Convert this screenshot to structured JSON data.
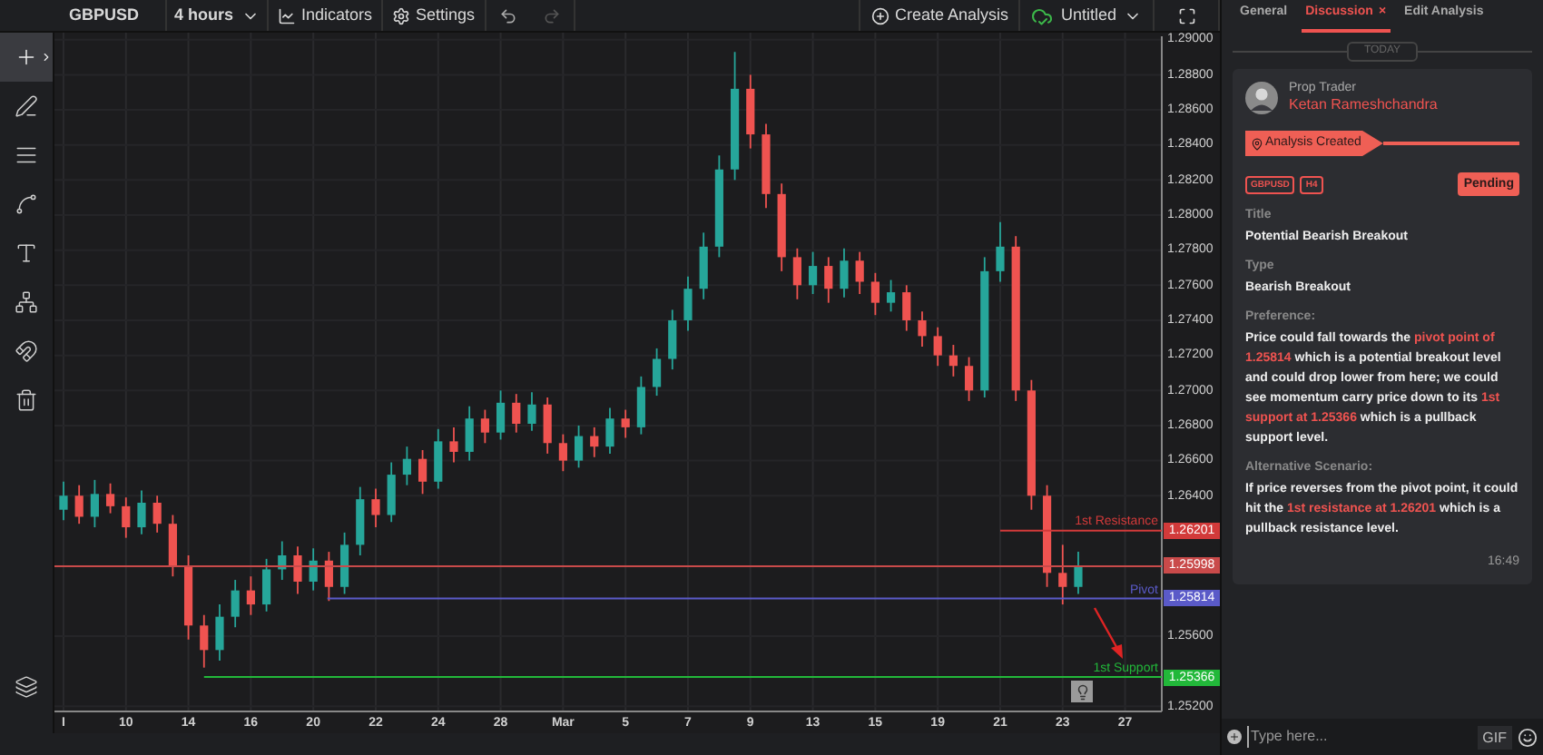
{
  "toolbar": {
    "symbol": "GBPUSD",
    "interval": "4 hours",
    "indicators": "Indicators",
    "settings": "Settings",
    "undo_disabled": false,
    "redo_disabled": true,
    "create": "Create Analysis",
    "layout": "Untitled"
  },
  "tools": [
    {
      "selected": true
    },
    {
      "selected": false
    },
    {
      "selected": false
    },
    {
      "selected": false
    },
    {
      "selected": false
    },
    {
      "selected": false
    },
    {
      "selected": false
    },
    {
      "selected": false
    },
    {
      "selected": false
    }
  ],
  "chart": {
    "chart_data": {
      "type": "candlestick",
      "ylim": [
        1.2517,
        1.2904
      ],
      "grid": true,
      "ref_lines": [
        {
          "axis": "y",
          "value": 1.26201,
          "color": "#d23a3a"
        },
        {
          "axis": "y",
          "value": 1.25998,
          "color": "#c94a4a"
        },
        {
          "axis": "y",
          "value": 1.25814,
          "color": "#5a5ac8"
        },
        {
          "axis": "y",
          "value": 1.25366,
          "color": "#22b83a"
        }
      ],
      "categories": [
        "I",
        null,
        null,
        null,
        "10",
        null,
        null,
        null,
        "14",
        null,
        null,
        null,
        "16",
        null,
        null,
        null,
        "20",
        null,
        null,
        null,
        "22",
        null,
        null,
        null,
        "24",
        null,
        null,
        null,
        "28",
        null,
        null,
        null,
        "Mar",
        null,
        null,
        null,
        "5",
        null,
        null,
        null,
        "7",
        null,
        null,
        null,
        "9",
        null,
        null,
        null,
        "13",
        null,
        null,
        null,
        "15",
        null,
        null,
        null,
        "19",
        null,
        null,
        null,
        "21",
        null,
        null,
        null,
        "23",
        null,
        null,
        null,
        "27"
      ],
      "ohlc": [
        [
          1.2632,
          1.2648,
          1.2626,
          1.264
        ],
        [
          1.264,
          1.2646,
          1.2624,
          1.2628
        ],
        [
          1.2628,
          1.2649,
          1.2622,
          1.2641
        ],
        [
          1.2641,
          1.2647,
          1.263,
          1.2634
        ],
        [
          1.2634,
          1.2639,
          1.2616,
          1.2622
        ],
        [
          1.2622,
          1.2643,
          1.2618,
          1.2636
        ],
        [
          1.2636,
          1.264,
          1.2619,
          1.2624
        ],
        [
          1.2624,
          1.2629,
          1.2594,
          1.26
        ],
        [
          1.26,
          1.2606,
          1.2558,
          1.2566
        ],
        [
          1.2566,
          1.2572,
          1.2542,
          1.2552
        ],
        [
          1.2552,
          1.2578,
          1.2546,
          1.2571
        ],
        [
          1.2571,
          1.2592,
          1.2565,
          1.2586
        ],
        [
          1.2586,
          1.2594,
          1.2572,
          1.2578
        ],
        [
          1.2578,
          1.2604,
          1.2574,
          1.2598
        ],
        [
          1.2598,
          1.2614,
          1.2592,
          1.2606
        ],
        [
          1.2606,
          1.2611,
          1.2584,
          1.2591
        ],
        [
          1.2591,
          1.261,
          1.2586,
          1.2603
        ],
        [
          1.2603,
          1.2608,
          1.258,
          1.2588
        ],
        [
          1.2588,
          1.2619,
          1.2584,
          1.2612
        ],
        [
          1.2612,
          1.2645,
          1.2606,
          1.2638
        ],
        [
          1.2638,
          1.2644,
          1.2622,
          1.2629
        ],
        [
          1.2629,
          1.2659,
          1.2625,
          1.2652
        ],
        [
          1.2652,
          1.2668,
          1.2646,
          1.2661
        ],
        [
          1.2661,
          1.2666,
          1.2641,
          1.2648
        ],
        [
          1.2648,
          1.2678,
          1.2644,
          1.2671
        ],
        [
          1.2671,
          1.2679,
          1.2659,
          1.2665
        ],
        [
          1.2665,
          1.2691,
          1.266,
          1.2684
        ],
        [
          1.2684,
          1.2689,
          1.267,
          1.2676
        ],
        [
          1.2676,
          1.27,
          1.2672,
          1.2693
        ],
        [
          1.2693,
          1.2698,
          1.2676,
          1.2681
        ],
        [
          1.2681,
          1.2699,
          1.2677,
          1.2692
        ],
        [
          1.2692,
          1.2696,
          1.2664,
          1.267
        ],
        [
          1.267,
          1.2675,
          1.2654,
          1.266
        ],
        [
          1.266,
          1.268,
          1.2656,
          1.2674
        ],
        [
          1.2674,
          1.2679,
          1.2662,
          1.2668
        ],
        [
          1.2668,
          1.269,
          1.2664,
          1.2684
        ],
        [
          1.2684,
          1.2689,
          1.2673,
          1.2679
        ],
        [
          1.2679,
          1.2708,
          1.2675,
          1.2702
        ],
        [
          1.2702,
          1.2724,
          1.2697,
          1.2718
        ],
        [
          1.2718,
          1.2746,
          1.2712,
          1.274
        ],
        [
          1.274,
          1.2765,
          1.2734,
          1.2758
        ],
        [
          1.2758,
          1.279,
          1.2752,
          1.2782
        ],
        [
          1.2782,
          1.2834,
          1.2776,
          1.2826
        ],
        [
          1.2826,
          1.2893,
          1.282,
          1.2872
        ],
        [
          1.2872,
          1.288,
          1.2838,
          1.2846
        ],
        [
          1.2846,
          1.2852,
          1.2804,
          1.2812
        ],
        [
          1.2812,
          1.2818,
          1.2768,
          1.2776
        ],
        [
          1.2776,
          1.2781,
          1.2752,
          1.276
        ],
        [
          1.276,
          1.2779,
          1.2755,
          1.2771
        ],
        [
          1.2771,
          1.2776,
          1.275,
          1.2758
        ],
        [
          1.2758,
          1.2781,
          1.2753,
          1.2774
        ],
        [
          1.2774,
          1.2779,
          1.2755,
          1.2762
        ],
        [
          1.2762,
          1.2767,
          1.2743,
          1.275
        ],
        [
          1.275,
          1.2763,
          1.2745,
          1.2756
        ],
        [
          1.2756,
          1.276,
          1.2734,
          1.274
        ],
        [
          1.274,
          1.2745,
          1.2725,
          1.2731
        ],
        [
          1.2731,
          1.2736,
          1.2714,
          1.272
        ],
        [
          1.272,
          1.2726,
          1.2708,
          1.2714
        ],
        [
          1.2714,
          1.2719,
          1.2694,
          1.27
        ],
        [
          1.27,
          1.2776,
          1.2696,
          1.2768
        ],
        [
          1.2768,
          1.2796,
          1.2762,
          1.2782
        ],
        [
          1.2782,
          1.2788,
          1.2694,
          1.27
        ],
        [
          1.27,
          1.2706,
          1.2632,
          1.264
        ],
        [
          1.264,
          1.2646,
          1.2588,
          1.2596
        ],
        [
          1.2596,
          1.2612,
          1.2578,
          1.2588
        ],
        [
          1.2588,
          1.2608,
          1.2584,
          1.26
        ],
        null,
        null,
        null
      ],
      "yticks": [
        {
          "value": 1.29,
          "label": "1.29000"
        },
        {
          "value": 1.288,
          "label": "1.28800"
        },
        {
          "value": 1.286,
          "label": "1.28600"
        },
        {
          "value": 1.284,
          "label": "1.28400"
        },
        {
          "value": 1.282,
          "label": "1.28200"
        },
        {
          "value": 1.28,
          "label": "1.28000"
        },
        {
          "value": 1.278,
          "label": "1.27800"
        },
        {
          "value": 1.276,
          "label": "1.27600"
        },
        {
          "value": 1.274,
          "label": "1.27400"
        },
        {
          "value": 1.272,
          "label": "1.27200"
        },
        {
          "value": 1.27,
          "label": "1.27000"
        },
        {
          "value": 1.268,
          "label": "1.26800"
        },
        {
          "value": 1.266,
          "label": "1.26600"
        },
        {
          "value": 1.264,
          "label": "1.26400"
        },
        {
          "value": 1.256,
          "label": "1.25600"
        },
        {
          "value": 1.252,
          "label": "1.25200"
        }
      ],
      "relative": false
    },
    "levels": [
      {
        "name": "1st Resistance",
        "price": "1.26201"
      },
      {
        "price": "1.25998"
      },
      {
        "name": "Pivot",
        "price": "1.25814"
      },
      {
        "name": "1st Support",
        "price": "1.25366"
      }
    ]
  },
  "panel": {
    "tabs": [
      {
        "label": "General",
        "selected": false,
        "closable": false
      },
      {
        "label": "Discussion",
        "selected": true,
        "closable": true,
        "close": "×"
      },
      {
        "label": "Edit Analysis",
        "selected": false,
        "closable": false
      }
    ],
    "divider": "TODAY",
    "message": {
      "role": "Prop Trader",
      "author": "Ketan Rameshchandra",
      "event": "Analysis Created",
      "tags": [
        "GBPUSD",
        "H4"
      ],
      "status": "Pending",
      "fields": [
        {
          "label": "Title",
          "value": [
            {
              "text": "Potential Bearish Breakout",
              "highlight": false
            }
          ]
        },
        {
          "label": "Type",
          "value": [
            {
              "text": "Bearish Breakout",
              "highlight": false
            }
          ]
        },
        {
          "label": "Preference:",
          "value": [
            {
              "text": "Price could fall towards the ",
              "highlight": false
            },
            {
              "text": "pivot point of 1.25814",
              "highlight": true
            },
            {
              "text": " which is a potential breakout level and could drop lower from here; we could see momentum carry price down to its ",
              "highlight": false
            },
            {
              "text": "1st support at 1.25366",
              "highlight": true
            },
            {
              "text": " which is a pullback support level.",
              "highlight": false
            }
          ]
        },
        {
          "label": "Alternative Scenario:",
          "value": [
            {
              "text": "If price reverses from the pivot point, it could hit the ",
              "highlight": false
            },
            {
              "text": "1st resistance at 1.26201",
              "highlight": true
            },
            {
              "text": " which is a pullback resistance level.",
              "highlight": false
            }
          ]
        }
      ],
      "time": "16:49"
    },
    "composer": {
      "placeholder": "Type here...",
      "gif": "GIF"
    }
  }
}
